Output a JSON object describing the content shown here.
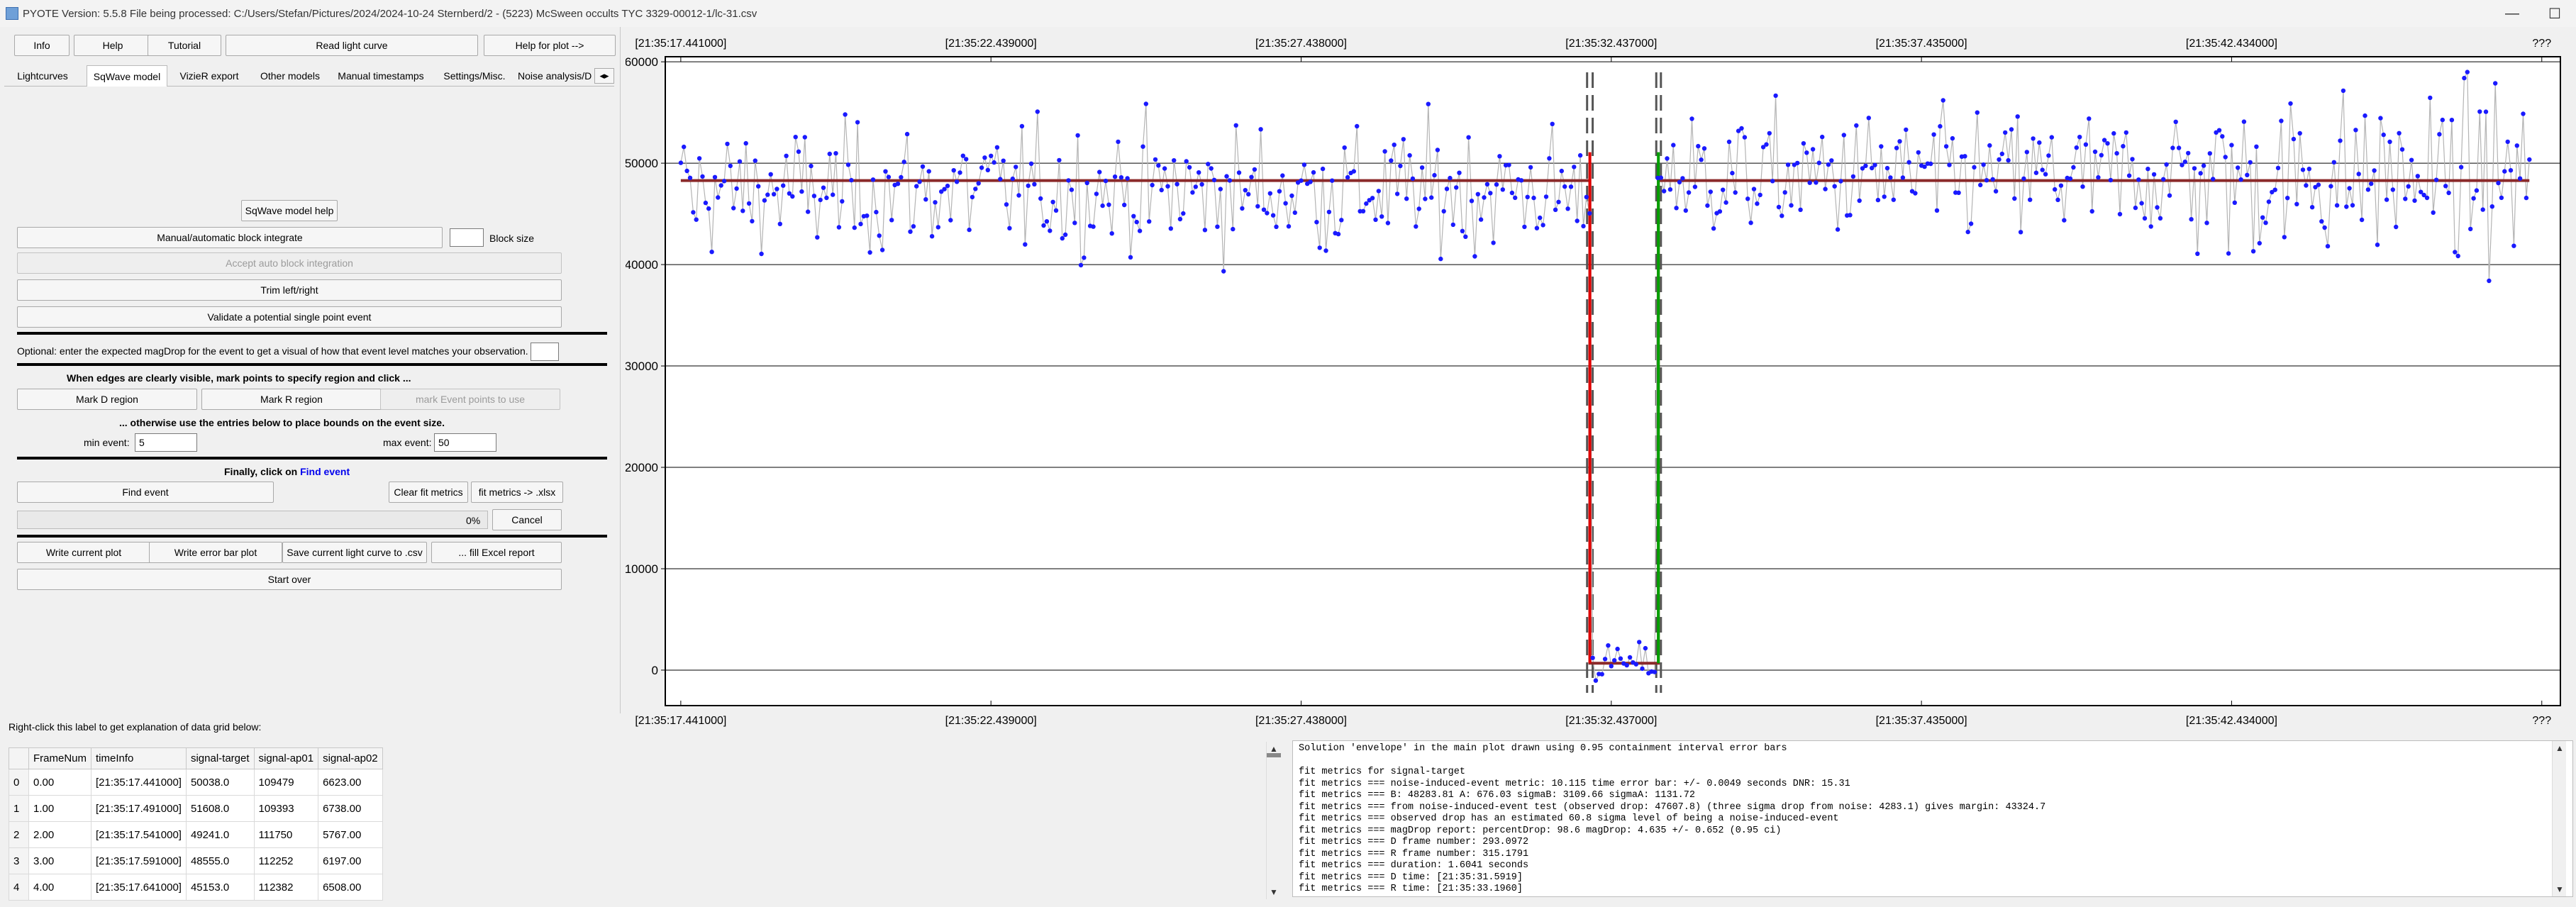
{
  "window": {
    "title": "PYOTE Version: 5.5.8  File being processed: C:/Users/Stefan/Pictures/2024/2024-10-24 Sternberd/2 - (5223) McSween occults TYC 3329-00012-1/lc-31.csv",
    "controls": [
      "minimize-icon",
      "maximize-icon",
      "close-icon"
    ],
    "controls_glyphs": [
      "—",
      "☐",
      "✕"
    ]
  },
  "top_buttons": {
    "info": "Info",
    "help": "Help",
    "tutorial": "Tutorial",
    "read_light_curve": "Read light curve",
    "help_for_plot": "Help for plot -->"
  },
  "tabs": [
    "Lightcurves",
    "SqWave model",
    "VizieR export",
    "Other models",
    "Manual timestamps",
    "Settings/Misc.",
    "Noise analysis/D"
  ],
  "active_tab": "SqWave model",
  "sqwave": {
    "model_help": "SqWave model help",
    "block_integrate": "Manual/automatic block integrate",
    "block_size_label": "Block size",
    "block_size_value": "",
    "accept_auto": "Accept auto block integration",
    "trim": "Trim left/right",
    "validate": "Validate a potential single point event",
    "magdrop_prompt": "Optional: enter the expected magDrop for the event to get a visual of how that event level matches your observation.",
    "magdrop_value": "",
    "edges_heading": "When edges are clearly visible, mark points to specify region and click ...",
    "mark_d": "Mark D region",
    "mark_r": "Mark R region",
    "mark_event": "mark Event points to use",
    "otherwise": "... otherwise use the entries below to place bounds on the event size.",
    "min_event_label": "min event:",
    "min_event_value": "5",
    "max_event_label": "max event:",
    "max_event_value": "50",
    "finally_prefix": "Finally, click on ",
    "finally_link": "Find event",
    "find_event": "Find event",
    "clear_fit": "Clear fit metrics",
    "fit_xlsx": "fit metrics -> .xlsx",
    "progress_text": "0%",
    "progress": 0,
    "cancel": "Cancel",
    "write_plot": "Write current plot",
    "write_error": "Write error bar plot",
    "save_csv": "Save current light curve to .csv",
    "fill_excel": "... fill Excel report",
    "start_over": "Start over"
  },
  "grid": {
    "hint": "Right-click this label to get explanation of data grid below:",
    "columns": [
      "",
      "FrameNum",
      "timeInfo",
      "signal-target",
      "signal-ap01",
      "signal-ap02"
    ],
    "rows": [
      [
        "0",
        "0.00",
        "[21:35:17.441000]",
        "50038.0",
        "109479",
        "6623.00"
      ],
      [
        "1",
        "1.00",
        "[21:35:17.491000]",
        "51608.0",
        "109393",
        "6738.00"
      ],
      [
        "2",
        "2.00",
        "[21:35:17.541000]",
        "49241.0",
        "111750",
        "5767.00"
      ],
      [
        "3",
        "3.00",
        "[21:35:17.591000]",
        "48555.0",
        "112252",
        "6197.00"
      ],
      [
        "4",
        "4.00",
        "[21:35:17.641000]",
        "45153.0",
        "112382",
        "6508.00"
      ]
    ]
  },
  "console_lines": [
    "Solution 'envelope' in the main plot drawn using 0.95 containment interval error bars",
    "",
    "fit metrics for signal-target",
    "fit metrics === noise-induced-event metric: 10.115 time error bar: +/- 0.0049 seconds DNR: 15.31",
    "fit metrics === B: 48283.81 A: 676.03 sigmaB: 3109.66 sigmaA: 1131.72",
    "fit metrics === from noise-induced-event test (observed drop: 47607.8) (three sigma drop from noise: 4283.1) gives margin: 43324.7",
    "fit metrics === observed drop has an estimated 60.8 sigma level of being a noise-induced-event",
    "fit metrics === magDrop report: percentDrop: 98.6 magDrop: 4.635 +/- 0.652 (0.95 ci)",
    "fit metrics === D frame number: 293.0972",
    "fit metrics === R frame number: 315.1791",
    "fit metrics === duration: 1.6041 seconds",
    "fit metrics === D time: [21:35:31.5919]",
    "fit metrics === R time: [21:35:33.1960]"
  ],
  "chart_data": {
    "type": "scatter",
    "title": "",
    "xlabel": "",
    "ylabel": "",
    "x_tick_labels": [
      "[21:35:17.441000]",
      "[21:35:22.439000]",
      "[21:35:27.438000]",
      "[21:35:32.437000]",
      "[21:35:37.435000]",
      "[21:35:42.434000]",
      "???"
    ],
    "x_tick_frames": [
      0,
      100,
      200,
      300,
      400,
      500,
      600
    ],
    "y_ticks": [
      0,
      10000,
      20000,
      30000,
      40000,
      50000,
      60000
    ],
    "y_tick_labels": [
      "0",
      "10000",
      "20000",
      "30000",
      "40000",
      "50000",
      "60000"
    ],
    "xlim": [
      -5,
      606
    ],
    "ylim": [
      -3500,
      60500
    ],
    "frame_count": 597,
    "baseline_B": 48283.81,
    "event_A": 676.03,
    "sigma_B": 3109.66,
    "sigma_A": 1131.72,
    "D_frame": 293.0972,
    "R_frame": 315.1791,
    "markers": [
      {
        "name": "D-edge",
        "frame": 293.0972,
        "color": "#e00000"
      },
      {
        "name": "R-edge",
        "frame": 315.1791,
        "color": "#00a000"
      }
    ],
    "envelope_frames": [
      [
        292.2,
        294.0
      ],
      [
        314.5,
        316.0
      ]
    ],
    "colors": {
      "points": "#1a1aff",
      "connector": "#b4b4b4",
      "model": "#8b2a2a",
      "grid": "#000000",
      "envelope": "#555555"
    }
  }
}
